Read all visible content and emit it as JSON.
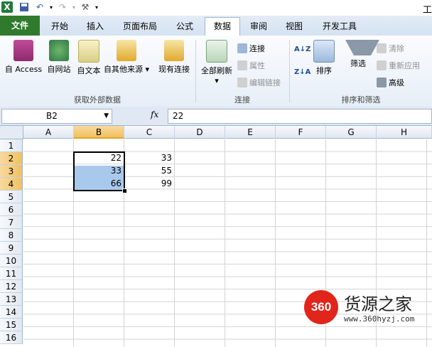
{
  "qat": {
    "title_fragment": "工"
  },
  "tabs": [
    "文件",
    "开始",
    "插入",
    "页面布局",
    "公式",
    "数据",
    "审阅",
    "视图",
    "开发工具"
  ],
  "ribbon": {
    "ext_data": {
      "access": "自 Access",
      "web": "自网站",
      "text": "自文本",
      "other": "自其他来源",
      "existing": "现有连接",
      "group_label": "获取外部数据"
    },
    "connections": {
      "refresh_all": "全部刷新",
      "connections": "连接",
      "properties": "属性",
      "edit_links": "编辑链接",
      "group_label": "连接"
    },
    "sort_filter": {
      "sort": "排序",
      "filter": "筛选",
      "clear": "清除",
      "reapply": "重新应用",
      "advanced": "高级",
      "group_label": "排序和筛选"
    }
  },
  "formula_bar": {
    "name_box": "B2",
    "fx": "fx",
    "value": "22"
  },
  "columns": [
    "A",
    "B",
    "C",
    "D",
    "E",
    "F",
    "G",
    "H"
  ],
  "rows": [
    "1",
    "2",
    "3",
    "4",
    "5",
    "6",
    "7",
    "8",
    "9",
    "10",
    "11",
    "12",
    "13",
    "14",
    "15",
    "16"
  ],
  "cells": {
    "B2": "22",
    "C2": "33",
    "B3": "33",
    "C3": "55",
    "B4": "66",
    "C4": "99"
  },
  "watermark": {
    "logo": "360",
    "name": "货源之家",
    "url": "www.360hyzj.com"
  },
  "colors": {
    "file_tab": "#2f7a2c",
    "selection_fill": "#a9c9ec",
    "header_selected": "#f1c15f",
    "logo_red": "#e1251b"
  }
}
